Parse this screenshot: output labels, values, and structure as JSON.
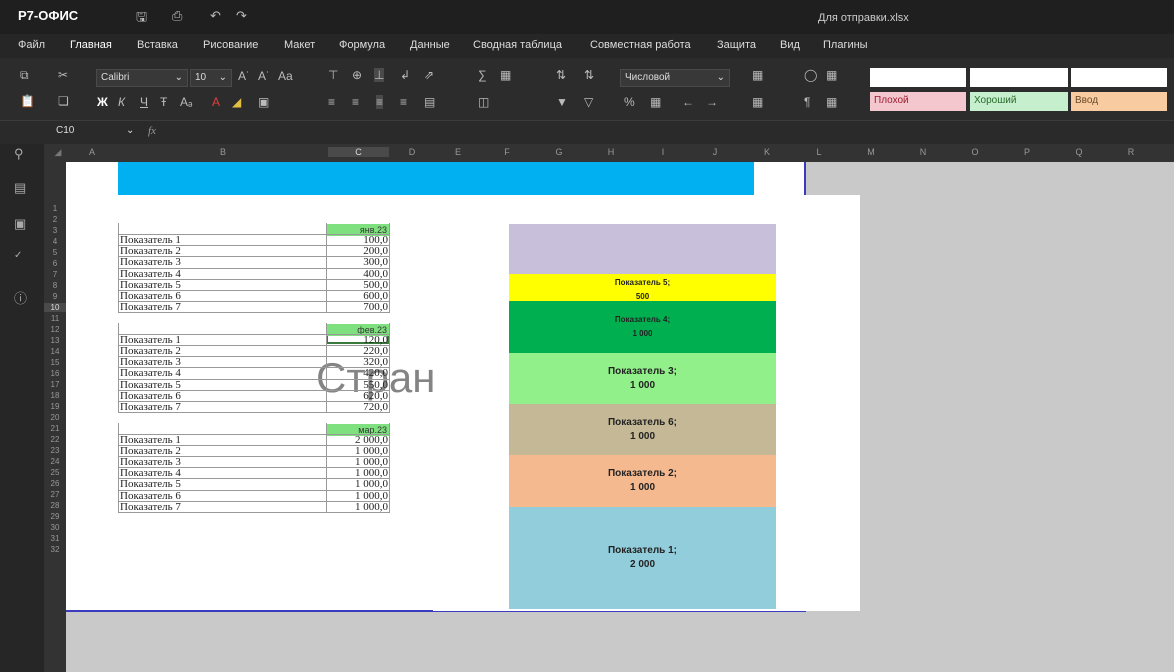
{
  "app": {
    "logo": "Р7-ОФИС",
    "document_title": "Для отправки.xlsx"
  },
  "menu": [
    "Файл",
    "Главная",
    "Вставка",
    "Рисование",
    "Макет",
    "Формула",
    "Данные",
    "Сводная таблица",
    "Совместная работа",
    "Защита",
    "Вид",
    "Плагины"
  ],
  "toolbar": {
    "font_name": "Calibri",
    "font_size": "10",
    "number_format": "Числовой",
    "bold": "Ж",
    "italic": "К",
    "underline": "Ч",
    "strike": "Ŧ",
    "styles": [
      {
        "label": "Плохой",
        "bg": "#f4c7ce",
        "fg": "#9c1b2f"
      },
      {
        "label": "Хороший",
        "bg": "#c6efce",
        "fg": "#2a6a2a"
      },
      {
        "label": "Ввод",
        "bg": "#f8cba0",
        "fg": "#6a4a2a"
      }
    ]
  },
  "formula_bar": {
    "cell_ref": "C10",
    "fx": "fx",
    "value": ""
  },
  "columns": [
    "A",
    "B",
    "C",
    "D",
    "E",
    "F",
    "G",
    "H",
    "I",
    "J",
    "K",
    "L",
    "M",
    "N",
    "O",
    "P",
    "Q",
    "R"
  ],
  "rows": [
    "1",
    "2",
    "3",
    "4",
    "5",
    "6",
    "7",
    "8",
    "9",
    "10",
    "11",
    "12",
    "13",
    "14",
    "15",
    "16",
    "17",
    "18",
    "19",
    "20",
    "21",
    "22",
    "23",
    "24",
    "25",
    "26",
    "27",
    "28",
    "29",
    "30",
    "31",
    "32"
  ],
  "watermark": "Стран",
  "blocks": [
    {
      "date": "янв.23",
      "items": [
        {
          "label": "Показатель 1",
          "value": "100,0"
        },
        {
          "label": "Показатель 2",
          "value": "200,0"
        },
        {
          "label": "Показатель 3",
          "value": "300,0"
        },
        {
          "label": "Показатель 4",
          "value": "400,0"
        },
        {
          "label": "Показатель 5",
          "value": "500,0"
        },
        {
          "label": "Показатель 6",
          "value": "600,0"
        },
        {
          "label": "Показатель 7",
          "value": "700,0"
        }
      ]
    },
    {
      "date": "фев.23",
      "items": [
        {
          "label": "Показатель 1",
          "value": "120,0"
        },
        {
          "label": "Показатель 2",
          "value": "220,0"
        },
        {
          "label": "Показатель 3",
          "value": "320,0"
        },
        {
          "label": "Показатель 4",
          "value": "420,0"
        },
        {
          "label": "Показатель 5",
          "value": "550,0"
        },
        {
          "label": "Показатель 6",
          "value": "620,0"
        },
        {
          "label": "Показатель 7",
          "value": "720,0"
        }
      ]
    },
    {
      "date": "мар.23",
      "items": [
        {
          "label": "Показатель 1",
          "value": "2 000,0"
        },
        {
          "label": "Показатель 2",
          "value": "1 000,0"
        },
        {
          "label": "Показатель 3",
          "value": "1 000,0"
        },
        {
          "label": "Показатель 4",
          "value": "1 000,0"
        },
        {
          "label": "Показатель 5",
          "value": "1 000,0"
        },
        {
          "label": "Показатель 6",
          "value": "1 000,0"
        },
        {
          "label": "Показатель 7",
          "value": "1 000,0"
        }
      ]
    }
  ],
  "chart": {
    "type": "stacked-bar",
    "segments": [
      {
        "name": "",
        "value": null,
        "color": "#c8bfdb"
      },
      {
        "name": "Показатель 5;",
        "value": "500",
        "color": "#ffff00"
      },
      {
        "name": "Показатель 4;",
        "value": "1 000",
        "color": "#00b050"
      },
      {
        "name": "Показатель 3;",
        "value": "1 000",
        "color": "#92f08a"
      },
      {
        "name": "Показатель 6;",
        "value": "1 000",
        "color": "#c4b896"
      },
      {
        "name": "Показатель 2;",
        "value": "1 000",
        "color": "#f5b98f"
      },
      {
        "name": "Показатель 1;",
        "value": "2 000",
        "color": "#92cddc"
      }
    ]
  }
}
